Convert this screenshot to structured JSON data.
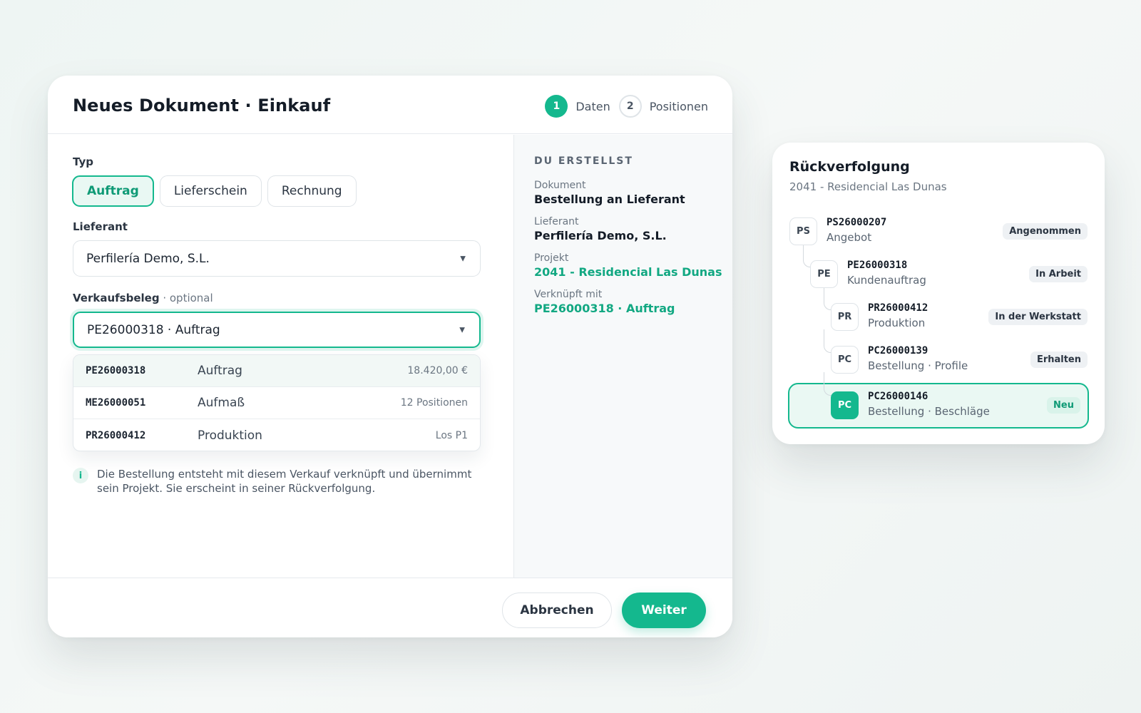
{
  "dialog": {
    "title": "Neues Dokument · Einkauf",
    "steps": [
      {
        "number": "1",
        "label": "Daten",
        "active": true
      },
      {
        "number": "2",
        "label": "Positionen",
        "active": false
      }
    ],
    "type_field": {
      "label": "Typ",
      "options": [
        "Auftrag",
        "Lieferschein",
        "Rechnung"
      ],
      "selected": "Auftrag"
    },
    "supplier_field": {
      "label": "Lieferant",
      "value": "Perfilería Demo, S.L."
    },
    "sales_doc_field": {
      "label": "Verkaufsbeleg",
      "optional_suffix": " · optional",
      "value": "PE26000318 · Auftrag",
      "options": [
        {
          "code": "PE26000318",
          "type": "Auftrag",
          "meta": "18.420,00 €"
        },
        {
          "code": "ME26000051",
          "type": "Aufmaß",
          "meta": "12 Positionen"
        },
        {
          "code": "PR26000412",
          "type": "Produktion",
          "meta": "Los P1"
        }
      ]
    },
    "info_icon": "info-icon",
    "info_text": "Die Bestellung entsteht mit diesem Verkauf verknüpft und übernimmt sein Projekt. Sie erscheint in seiner Rückverfolgung.",
    "summary": {
      "heading": "DU ERSTELLST",
      "items": [
        {
          "label": "Dokument",
          "value": "Bestellung an Lieferant"
        },
        {
          "label": "Lieferant",
          "value": "Perfilería Demo, S.L."
        },
        {
          "label": "Projekt",
          "value": "2041 - Residencial Las Dunas"
        },
        {
          "label": "Verknüpft mit",
          "value": "PE26000318 · Auftrag"
        }
      ]
    },
    "footer": {
      "cancel_label": "Abbrechen",
      "next_label": "Weiter"
    }
  },
  "trace": {
    "title": "Rückverfolgung",
    "subtitle": "2041 - Residencial Las Dunas",
    "nodes": [
      {
        "badge": "PS",
        "code": "PS26000207",
        "desc": "Angebot",
        "status": "Angenommen"
      },
      {
        "badge": "PE",
        "code": "PE26000318",
        "desc": "Kundenauftrag",
        "status": "In Arbeit"
      },
      {
        "badge": "PR",
        "code": "PR26000412",
        "desc": "Produktion",
        "status": "In der Werkstatt"
      },
      {
        "badge": "PC",
        "code": "PC26000139",
        "desc": "Bestellung · Profile",
        "status": "Erhalten"
      },
      {
        "badge": "PC",
        "code": "PC26000146",
        "desc": "Bestellung · Beschläge",
        "status": "Neu"
      }
    ]
  },
  "colors": {
    "accent": "#14b88e",
    "accent_dark": "#0f9a76",
    "text": "#141c27",
    "muted": "#6b7682"
  }
}
